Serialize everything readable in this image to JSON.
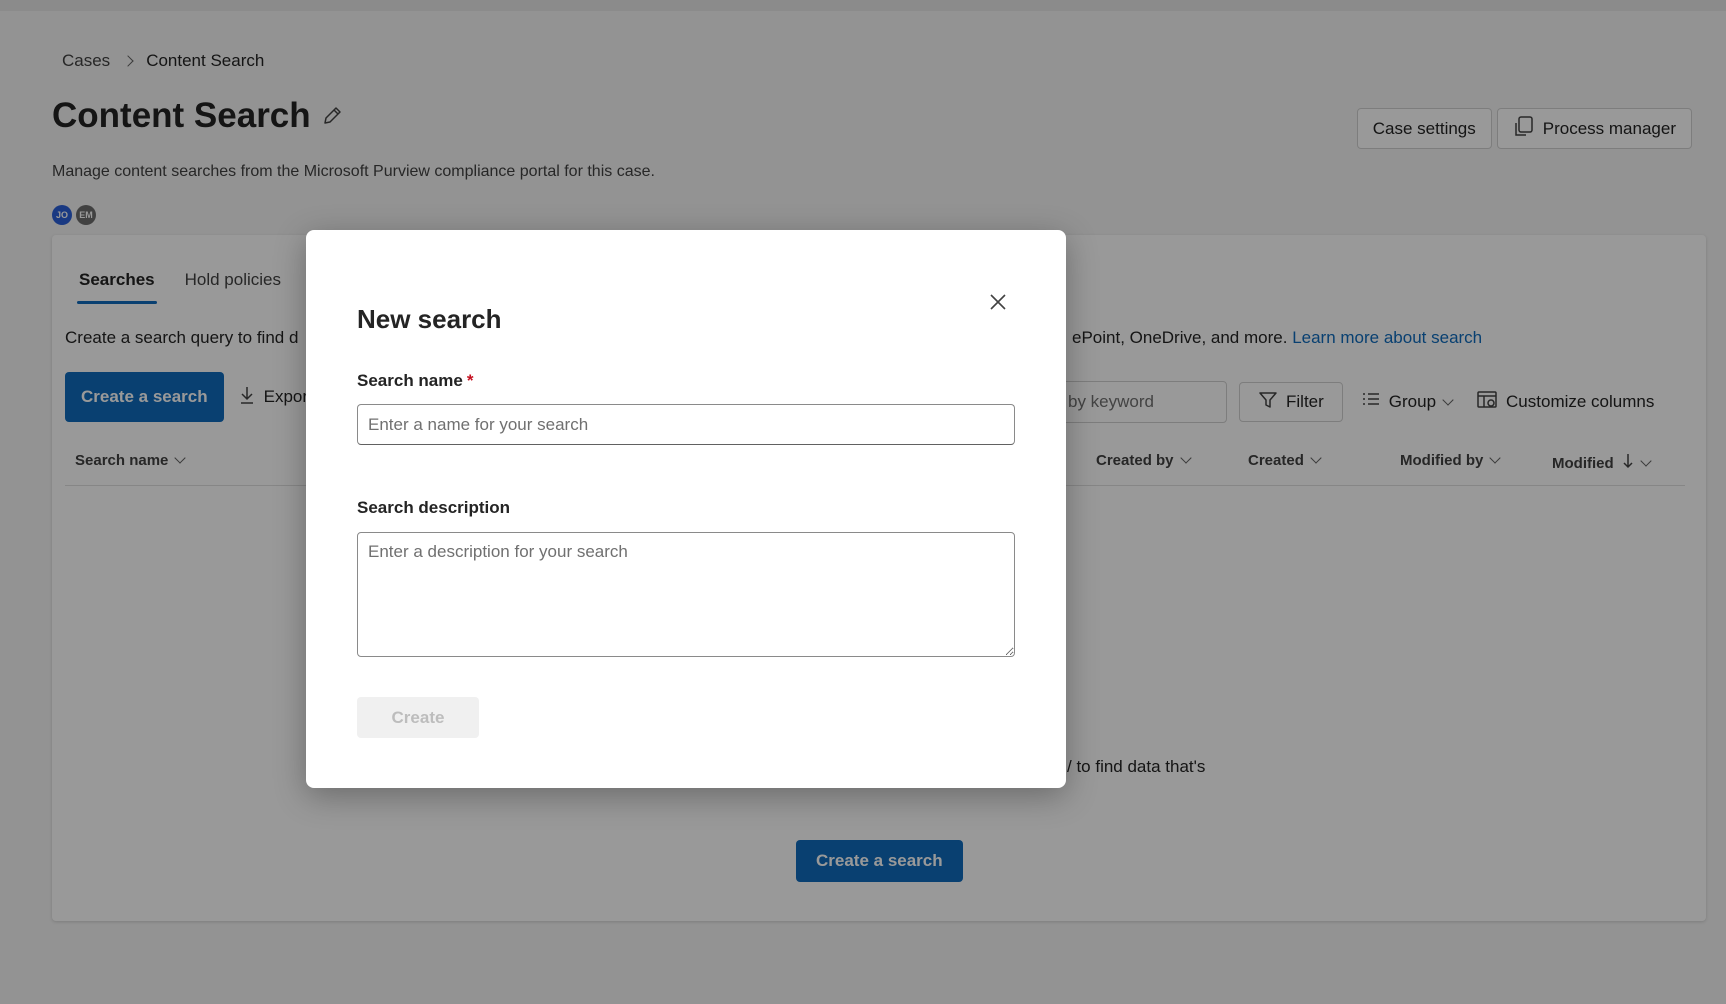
{
  "breadcrumb": {
    "root": "Cases",
    "current": "Content Search"
  },
  "header": {
    "title": "Content Search",
    "subtitle": "Manage content searches from the Microsoft Purview compliance portal for this case.",
    "avatars": [
      "JO",
      "EM"
    ],
    "case_settings_label": "Case settings",
    "process_manager_label": "Process manager"
  },
  "tabs": [
    {
      "label": "Searches",
      "active": true
    },
    {
      "label": "Hold policies",
      "active": false
    }
  ],
  "description": {
    "left": "Create a search query to find d",
    "right": "ePoint, OneDrive, and more.",
    "link": "Learn more about search"
  },
  "toolbar": {
    "create_label": "Create a search",
    "export_label": "Expor",
    "search_placeholder": "by keyword",
    "filter_label": "Filter",
    "group_label": "Group",
    "customize_label": "Customize columns"
  },
  "columns": [
    "Search name",
    "Created by",
    "Created",
    "Modified by",
    "Modified"
  ],
  "empty_state": {
    "text": "/ to find data that's",
    "button_label": "Create a search"
  },
  "dialog": {
    "title": "New search",
    "name_label": "Search name",
    "name_required_mark": "*",
    "name_placeholder": "Enter a name for your search",
    "desc_label": "Search description",
    "desc_placeholder": "Enter a description for your search",
    "create_label": "Create"
  },
  "colors": {
    "accent": "#0f6cbd",
    "required": "#c50f1f",
    "overlay": "rgba(0,0,0,0.4)"
  }
}
